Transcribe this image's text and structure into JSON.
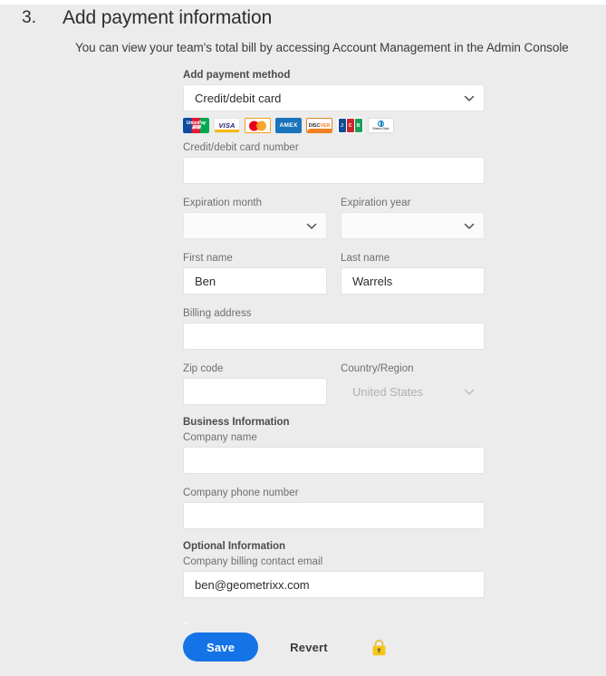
{
  "section": {
    "number": "3.",
    "title": "Add payment information",
    "description": "You can view your team's total bill by accessing Account Management in the Admin Console"
  },
  "form": {
    "payment_method": {
      "label": "Add payment method",
      "value": "Credit/debit card",
      "chevron_icon": "chevron-down-icon"
    },
    "card_logos": [
      {
        "name": "unionpay-logo",
        "label": "UnionPay"
      },
      {
        "name": "visa-logo",
        "label": "VISA"
      },
      {
        "name": "mastercard-logo",
        "label": "Mastercard"
      },
      {
        "name": "amex-logo",
        "label": "AMEX"
      },
      {
        "name": "discover-logo",
        "label": "DISCOVER"
      },
      {
        "name": "jcb-logo",
        "label": "JCB"
      },
      {
        "name": "diners-club-logo",
        "label": "Diners Club"
      }
    ],
    "card_number": {
      "label": "Credit/debit card number",
      "value": ""
    },
    "expiration_month": {
      "label": "Expiration month",
      "value": ""
    },
    "expiration_year": {
      "label": "Expiration year",
      "value": ""
    },
    "first_name": {
      "label": "First name",
      "value": "Ben"
    },
    "last_name": {
      "label": "Last name",
      "value": "Warrels"
    },
    "billing_address": {
      "label": "Billing address",
      "value": ""
    },
    "zip_code": {
      "label": "Zip code",
      "value": ""
    },
    "country_region": {
      "label": "Country/Region",
      "value": "United States",
      "disabled": true
    },
    "business_information": {
      "heading": "Business Information",
      "company_name": {
        "label": "Company name",
        "value": ""
      },
      "company_phone": {
        "label": "Company phone number",
        "value": ""
      }
    },
    "optional_information": {
      "heading": "Optional Information",
      "billing_contact_email": {
        "label": "Company billing contact email",
        "value": "ben@geometrixx.com"
      }
    }
  },
  "footer": {
    "save_label": "Save",
    "revert_label": "Revert",
    "lock_icon": "lock-icon"
  },
  "colors": {
    "page_background": "#ececec",
    "accent_blue": "#1473e6",
    "input_background": "#ffffff",
    "label_gray": "#6e6e6e",
    "lock_yellow": "#f5c518"
  }
}
